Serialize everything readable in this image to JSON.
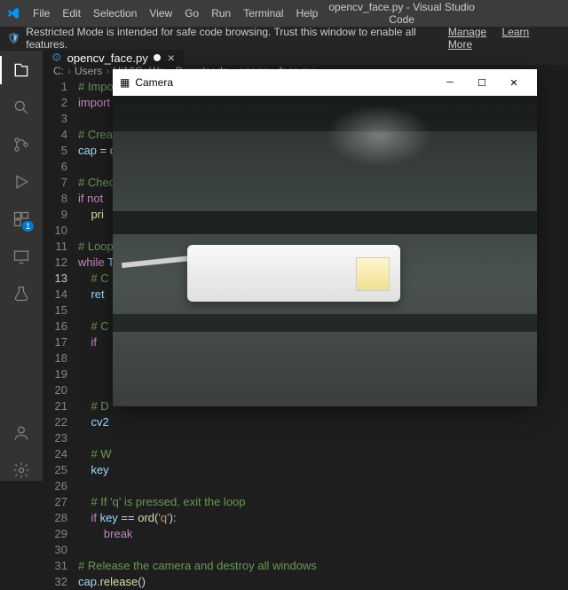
{
  "menubar": {
    "items": [
      "File",
      "Edit",
      "Selection",
      "View",
      "Go",
      "Run",
      "Terminal",
      "Help"
    ],
    "title": "opencv_face.py - Visual Studio Code"
  },
  "restricted": {
    "msg": "Restricted Mode is intended for safe code browsing. Trust this window to enable all features.",
    "manage": "Manage",
    "learn": "Learn More"
  },
  "tab": {
    "filename": "opencv_face.py",
    "dirty": "●"
  },
  "breadcrumb": {
    "parts": [
      "C:",
      "Users",
      "Hi10GeWa",
      "Downloads",
      "opencv_face.py"
    ]
  },
  "code": {
    "lines": [
      {
        "n": 1,
        "html": "<span class='c-comment'># Impor</span>"
      },
      {
        "n": 2,
        "html": "<span class='c-keyword'>import</span> "
      },
      {
        "n": 3,
        "html": ""
      },
      {
        "n": 4,
        "html": "<span class='c-comment'># Creat</span>"
      },
      {
        "n": 5,
        "html": "<span class='c-var'>cap</span> = <span class='c-var'>c</span>"
      },
      {
        "n": 6,
        "html": ""
      },
      {
        "n": 7,
        "html": "<span class='c-comment'># Check</span>"
      },
      {
        "n": 8,
        "html": "<span class='c-keyword'>if</span> <span class='c-keyword'>not</span> "
      },
      {
        "n": 9,
        "html": "    <span class='c-func'>pri</span>"
      },
      {
        "n": 10,
        "html": ""
      },
      {
        "n": 11,
        "html": "<span class='c-comment'># Loop</span>"
      },
      {
        "n": 12,
        "html": "<span class='c-keyword'>while</span> <span class='c-var'>T</span>"
      },
      {
        "n": 13,
        "html": "    <span class='c-comment'># C</span>",
        "cur": true
      },
      {
        "n": 14,
        "html": "    <span class='c-var'>ret</span>"
      },
      {
        "n": 15,
        "html": ""
      },
      {
        "n": 16,
        "html": "    <span class='c-comment'># C</span>"
      },
      {
        "n": 17,
        "html": "    <span class='c-keyword'>if</span> "
      },
      {
        "n": 18,
        "html": "        "
      },
      {
        "n": 19,
        "html": ""
      },
      {
        "n": 20,
        "html": ""
      },
      {
        "n": 21,
        "html": "    <span class='c-comment'># D</span>"
      },
      {
        "n": 22,
        "html": "    <span class='c-var'>cv2</span>"
      },
      {
        "n": 23,
        "html": ""
      },
      {
        "n": 24,
        "html": "    <span class='c-comment'># W</span>"
      },
      {
        "n": 25,
        "html": "    <span class='c-var'>key</span>"
      },
      {
        "n": 26,
        "html": ""
      },
      {
        "n": 27,
        "html": "    <span class='c-comment'># If 'q' is pressed, exit the loop</span>"
      },
      {
        "n": 28,
        "html": "    <span class='c-keyword'>if</span> <span class='c-var'>key</span> == <span class='c-func'>ord</span>(<span class='c-string'>'q'</span>):"
      },
      {
        "n": 29,
        "html": "        <span class='c-keyword'>break</span>"
      },
      {
        "n": 30,
        "html": ""
      },
      {
        "n": 31,
        "html": "<span class='c-comment'># Release the camera and destroy all windows</span>"
      },
      {
        "n": 32,
        "html": "<span class='c-var'>cap</span>.<span class='c-func'>release</span>()"
      }
    ]
  },
  "activity": {
    "badge_ext": "1"
  },
  "camera": {
    "title": "Camera"
  }
}
